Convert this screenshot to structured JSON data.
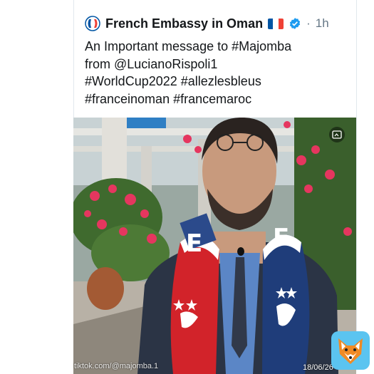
{
  "tweet": {
    "account_name": "French Embassy in Oman",
    "separator": "·",
    "time": "1h",
    "text_lines": [
      "An Important message to #Majomba",
      "from @LucianoRispoli1",
      "#WorldCup2022 #allezlesbleus",
      "#franceinoman #francemaroc"
    ]
  },
  "overlay": {
    "watermark": "tiktok.com/@majomba.1",
    "datestamp": "18/06/26"
  },
  "icons": {
    "logo": "french-embassy-logo-icon",
    "flag": "france-flag-icon",
    "verified": "verified-badge-icon",
    "media_badge": "gif-badge-icon",
    "app_logo": "fox-logo-icon"
  },
  "colors": {
    "verified_blue": "#1d9bf0",
    "flag_blue": "#0055a4",
    "flag_white": "#ffffff",
    "flag_red": "#ef4135",
    "text_dark": "#14171a",
    "text_grey": "#657786"
  }
}
